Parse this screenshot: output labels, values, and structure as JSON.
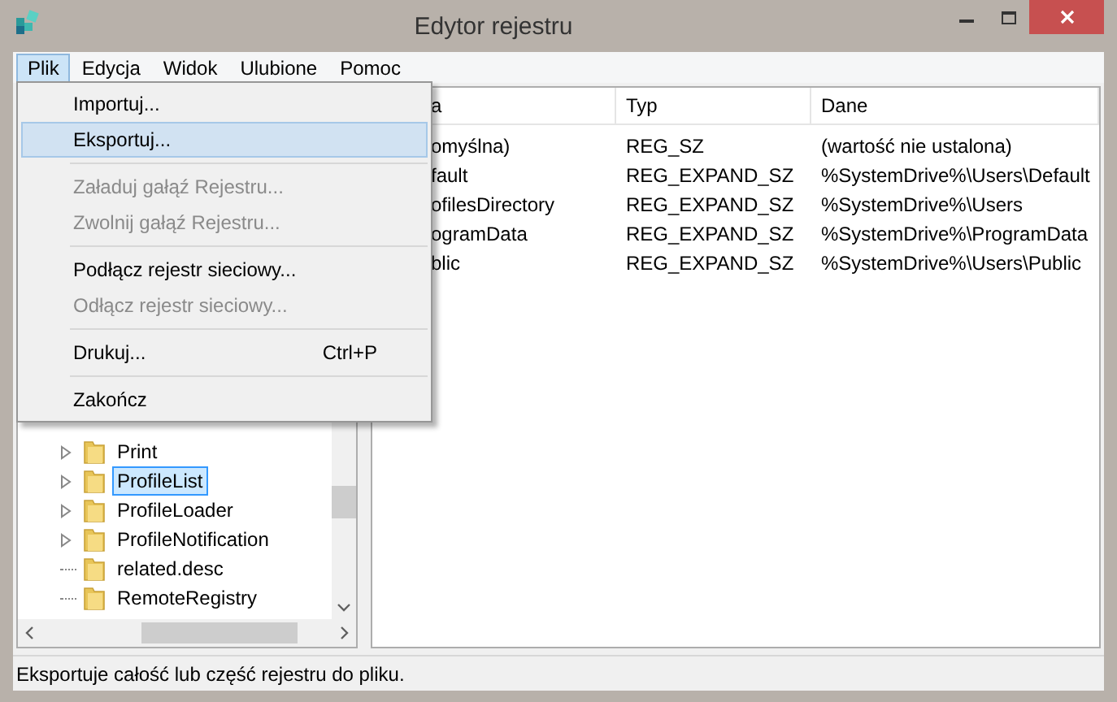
{
  "window": {
    "title": "Edytor rejestru"
  },
  "menubar": [
    {
      "label": "Plik",
      "selected": true
    },
    {
      "label": "Edycja",
      "selected": false
    },
    {
      "label": "Widok",
      "selected": false
    },
    {
      "label": "Ulubione",
      "selected": false
    },
    {
      "label": "Pomoc",
      "selected": false
    }
  ],
  "menu": {
    "groups": [
      [
        {
          "label": "Importuj...",
          "disabled": false,
          "selected": false
        },
        {
          "label": "Eksportuj...",
          "disabled": false,
          "selected": true
        }
      ],
      [
        {
          "label": "Załaduj gałąź Rejestru...",
          "disabled": true,
          "selected": false
        },
        {
          "label": "Zwolnij gałąź Rejestru...",
          "disabled": true,
          "selected": false
        }
      ],
      [
        {
          "label": "Podłącz rejestr sieciowy...",
          "disabled": false,
          "selected": false
        },
        {
          "label": "Odłącz rejestr sieciowy...",
          "disabled": true,
          "selected": false
        }
      ],
      [
        {
          "label": "Drukuj...",
          "shortcut": "Ctrl+P",
          "disabled": false,
          "selected": false
        }
      ],
      [
        {
          "label": "Zakończ",
          "disabled": false,
          "selected": false
        }
      ]
    ]
  },
  "tree": {
    "items": [
      {
        "label": "Print",
        "expandable": true,
        "selected": false
      },
      {
        "label": "ProfileList",
        "expandable": true,
        "selected": true
      },
      {
        "label": "ProfileLoader",
        "expandable": true,
        "selected": false
      },
      {
        "label": "ProfileNotification",
        "expandable": true,
        "selected": false
      },
      {
        "label": "related.desc",
        "expandable": false,
        "selected": false
      },
      {
        "label": "RemoteRegistry",
        "expandable": false,
        "selected": false
      }
    ]
  },
  "table": {
    "columns": [
      "a",
      "Typ",
      "Dane"
    ],
    "rows": [
      [
        "omyślna)",
        "REG_SZ",
        "(wartość nie ustalona)"
      ],
      [
        "fault",
        "REG_EXPAND_SZ",
        "%SystemDrive%\\Users\\Default"
      ],
      [
        "ofilesDirectory",
        "REG_EXPAND_SZ",
        "%SystemDrive%\\Users"
      ],
      [
        "ogramData",
        "REG_EXPAND_SZ",
        "%SystemDrive%\\ProgramData"
      ],
      [
        "blic",
        "REG_EXPAND_SZ",
        "%SystemDrive%\\Users\\Public"
      ]
    ]
  },
  "status_bar": "Eksportuje całość lub część rejestru do pliku."
}
